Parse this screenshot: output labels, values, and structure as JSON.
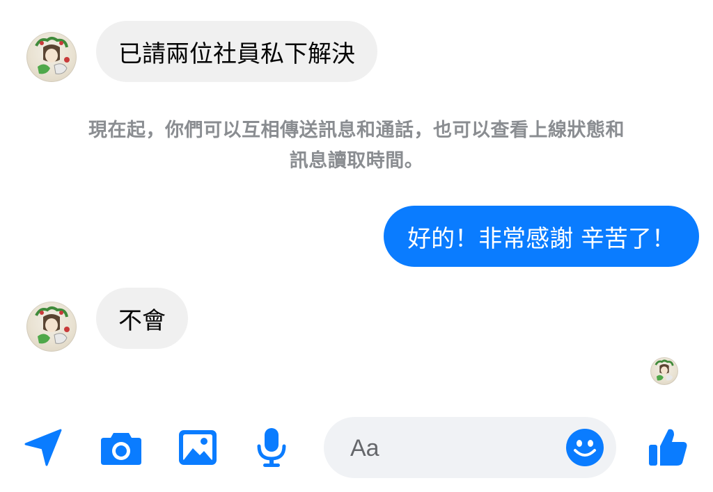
{
  "colors": {
    "accent": "#0a7cff",
    "incoming_bubble": "#f0f0f0",
    "system_text": "#8a8d91"
  },
  "messages": [
    {
      "direction": "incoming",
      "text": "已請兩位社員私下解決"
    },
    {
      "direction": "outgoing",
      "text": "好的！非常感謝 辛苦了！"
    },
    {
      "direction": "incoming",
      "text": "不會"
    }
  ],
  "system_note": {
    "line1": "現在起，你們可以互相傳送訊息和通話，也可以查看上線狀態和",
    "line2": "訊息讀取時間。"
  },
  "toolbar": {
    "icons": [
      "location-arrow-icon",
      "camera-icon",
      "image-icon",
      "microphone-icon",
      "emoji-icon",
      "thumbs-up-icon"
    ]
  },
  "composer": {
    "placeholder": "Aa",
    "value": ""
  }
}
